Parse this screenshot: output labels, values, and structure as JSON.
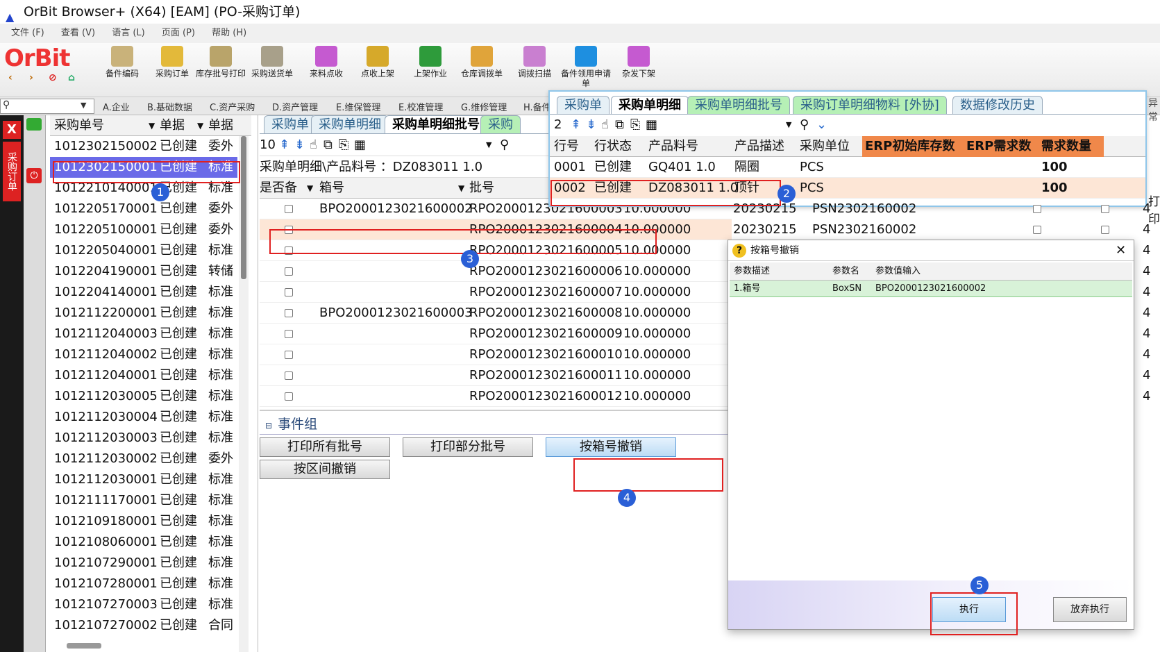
{
  "window": {
    "title": "OrBit Browser+ (X64) [EAM] (PO-采购订单)"
  },
  "menu": [
    "文件 (F)",
    "查看 (V)",
    "语言 (L)",
    "页面 (P)",
    "帮助 (H)"
  ],
  "logo": "OrBit",
  "toolbar": [
    "备件编码",
    "采购订单",
    "库存批号打印",
    "采购送货单",
    "来料点收",
    "点收上架",
    "上架作业",
    "仓库调拨单",
    "调拨扫描",
    "备件领用申请单",
    "杂发下架"
  ],
  "modules": [
    "A.企业",
    "B.基础数据",
    "C.资产采购",
    "D.资产管理",
    "E.维保管理",
    "E.校准管理",
    "G.维修管理",
    "H.备件"
  ],
  "sidebar": {
    "label": "采购订单",
    "close": "X"
  },
  "order_list": {
    "columns": [
      "采购单号",
      "单据",
      "单据"
    ],
    "rows": [
      [
        "1012302150002",
        "已创建",
        "委外"
      ],
      [
        "1012302150001",
        "已创建",
        "标准"
      ],
      [
        "1012210140001",
        "已创建",
        "标准"
      ],
      [
        "1012205170001",
        "已创建",
        "委外"
      ],
      [
        "1012205100001",
        "已创建",
        "委外"
      ],
      [
        "1012205040001",
        "已创建",
        "标准"
      ],
      [
        "1012204190001",
        "已创建",
        "转储"
      ],
      [
        "1012204140001",
        "已创建",
        "标准"
      ],
      [
        "1012112200001",
        "已创建",
        "标准"
      ],
      [
        "1012112040003",
        "已创建",
        "标准"
      ],
      [
        "1012112040002",
        "已创建",
        "标准"
      ],
      [
        "1012112040001",
        "已创建",
        "标准"
      ],
      [
        "1012112030005",
        "已创建",
        "标准"
      ],
      [
        "1012112030004",
        "已创建",
        "标准"
      ],
      [
        "1012112030003",
        "已创建",
        "标准"
      ],
      [
        "1012112030002",
        "已创建",
        "委外"
      ],
      [
        "1012112030001",
        "已创建",
        "标准"
      ],
      [
        "1012111170001",
        "已创建",
        "标准"
      ],
      [
        "1012109180001",
        "已创建",
        "标准"
      ],
      [
        "1012108060001",
        "已创建",
        "标准"
      ],
      [
        "1012107290001",
        "已创建",
        "标准"
      ],
      [
        "1012107280001",
        "已创建",
        "标准"
      ],
      [
        "1012107270003",
        "已创建",
        "标准"
      ],
      [
        "1012107270002",
        "已创建",
        "合同"
      ]
    ]
  },
  "mid": {
    "tabs": [
      "采购单",
      "采购单明细",
      "采购单明细批号",
      "采购"
    ],
    "count": "10",
    "path": "采购单明细\\产品料号 ：DZ083011 1.0",
    "columns": [
      "是否备",
      "箱号",
      "批号"
    ],
    "rows": [
      {
        "box": "BPO2000123021600002",
        "lot": "RPO2000123021600003",
        "qty": "10.000000",
        "date": "20230215",
        "psn": "PSN2302160002",
        "x": "4"
      },
      {
        "box": "",
        "lot": "RPO2000123021600004",
        "qty": "10.000000",
        "date": "20230215",
        "psn": "PSN2302160002",
        "x": "4"
      },
      {
        "box": "",
        "lot": "RPO2000123021600005",
        "qty": "10.000000",
        "date": "",
        "psn": "",
        "x": "4"
      },
      {
        "box": "",
        "lot": "RPO2000123021600006",
        "qty": "10.000000",
        "date": "",
        "psn": "",
        "x": "4"
      },
      {
        "box": "",
        "lot": "RPO2000123021600007",
        "qty": "10.000000",
        "date": "",
        "psn": "",
        "x": "4"
      },
      {
        "box": "BPO2000123021600003",
        "lot": "RPO2000123021600008",
        "qty": "10.000000",
        "date": "",
        "psn": "",
        "x": "4"
      },
      {
        "box": "",
        "lot": "RPO2000123021600009",
        "qty": "10.000000",
        "date": "",
        "psn": "",
        "x": "4"
      },
      {
        "box": "",
        "lot": "RPO2000123021600010",
        "qty": "10.000000",
        "date": "",
        "psn": "",
        "x": "4"
      },
      {
        "box": "",
        "lot": "RPO2000123021600011",
        "qty": "10.000000",
        "date": "",
        "psn": "",
        "x": "4"
      },
      {
        "box": "",
        "lot": "RPO2000123021600012",
        "qty": "10.000000",
        "date": "",
        "psn": "",
        "x": "4"
      }
    ],
    "events": {
      "title": "事件组",
      "buttons": [
        "打印所有批号",
        "打印部分批号",
        "按箱号撤销",
        "按区间撤销"
      ]
    }
  },
  "detail": {
    "tabs": [
      "采购单",
      "采购单明细",
      "采购单明细批号",
      "采购订单明细物料 [外协]",
      "数据修改历史"
    ],
    "count": "2",
    "columns": [
      "行号",
      "行状态",
      "产品料号",
      "产品描述",
      "采购单位",
      "ERP初始库存数",
      "ERP需求数",
      "需求数量"
    ],
    "rows": [
      [
        "0001",
        "已创建",
        "GQ401 1.0",
        "隔圈",
        "PCS",
        "",
        "",
        "100"
      ],
      [
        "0002",
        "已创建",
        "DZ083011 1.0",
        "顶针",
        "PCS",
        "",
        "",
        "100"
      ]
    ],
    "right_clip": [
      "异常",
      "打印"
    ]
  },
  "dialog": {
    "title": "按箱号撤销",
    "columns": [
      "参数描述",
      "参数名",
      "参数值输入"
    ],
    "rows": [
      [
        "1.箱号",
        "BoxSN",
        "BPO2000123021600002"
      ]
    ],
    "execute": "执行",
    "cancel": "放弃执行"
  },
  "badges": [
    "1",
    "2",
    "3",
    "4",
    "5"
  ]
}
